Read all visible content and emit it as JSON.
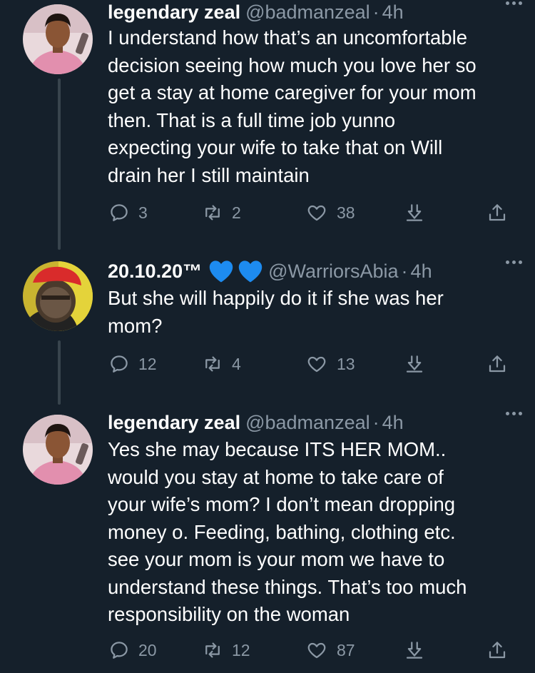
{
  "tweets": [
    {
      "name": "legendary zeal",
      "handle": "@badmanzeal",
      "separator": "·",
      "time": "4h",
      "avatar_icon": "profile-photo-man-pink-shirt",
      "lines": [
        "I understand how that’s an uncomfortable",
        "decision seeing how much you love her  so",
        "get a stay at home caregiver for your mom",
        "then. That is a full time job yunno",
        "expecting your wife to take that on Will",
        "drain her I still maintain"
      ],
      "replies": "3",
      "retweets": "2",
      "likes": "38"
    },
    {
      "name": "20.10.20™",
      "name_emoji": "💙💙",
      "handle": "@WarriorsAbia",
      "separator": "·",
      "time": "4h",
      "avatar_icon": "profile-photo-man-red-cap",
      "lines": [
        "But she will happily do it if she was her",
        "mom?"
      ],
      "replies": "12",
      "retweets": "4",
      "likes": "13"
    },
    {
      "name": "legendary zeal",
      "handle": "@badmanzeal",
      "separator": "·",
      "time": "4h",
      "avatar_icon": "profile-photo-man-pink-shirt",
      "lines": [
        "Yes she may because ITS HER MOM..",
        "would you stay at home to take care of",
        "your wife’s mom? I don’t mean dropping",
        "money o. Feeding, bathing, clothing etc.",
        "see your mom is your mom we have to",
        "understand these things. That’s too much",
        "responsibility on the woman"
      ],
      "replies": "20",
      "retweets": "12",
      "likes": "87"
    }
  ],
  "icons": {
    "reply": "reply-icon",
    "retweet": "retweet-icon",
    "like": "heart-icon",
    "bookmark": "bookmark-icon",
    "share": "share-icon",
    "more": "more-options-icon"
  },
  "colors": {
    "background": "#15202b",
    "text": "#ffffff",
    "secondary": "#8b98a5",
    "thread_line": "#38444d",
    "emoji_heart": "#1d8bf0"
  }
}
